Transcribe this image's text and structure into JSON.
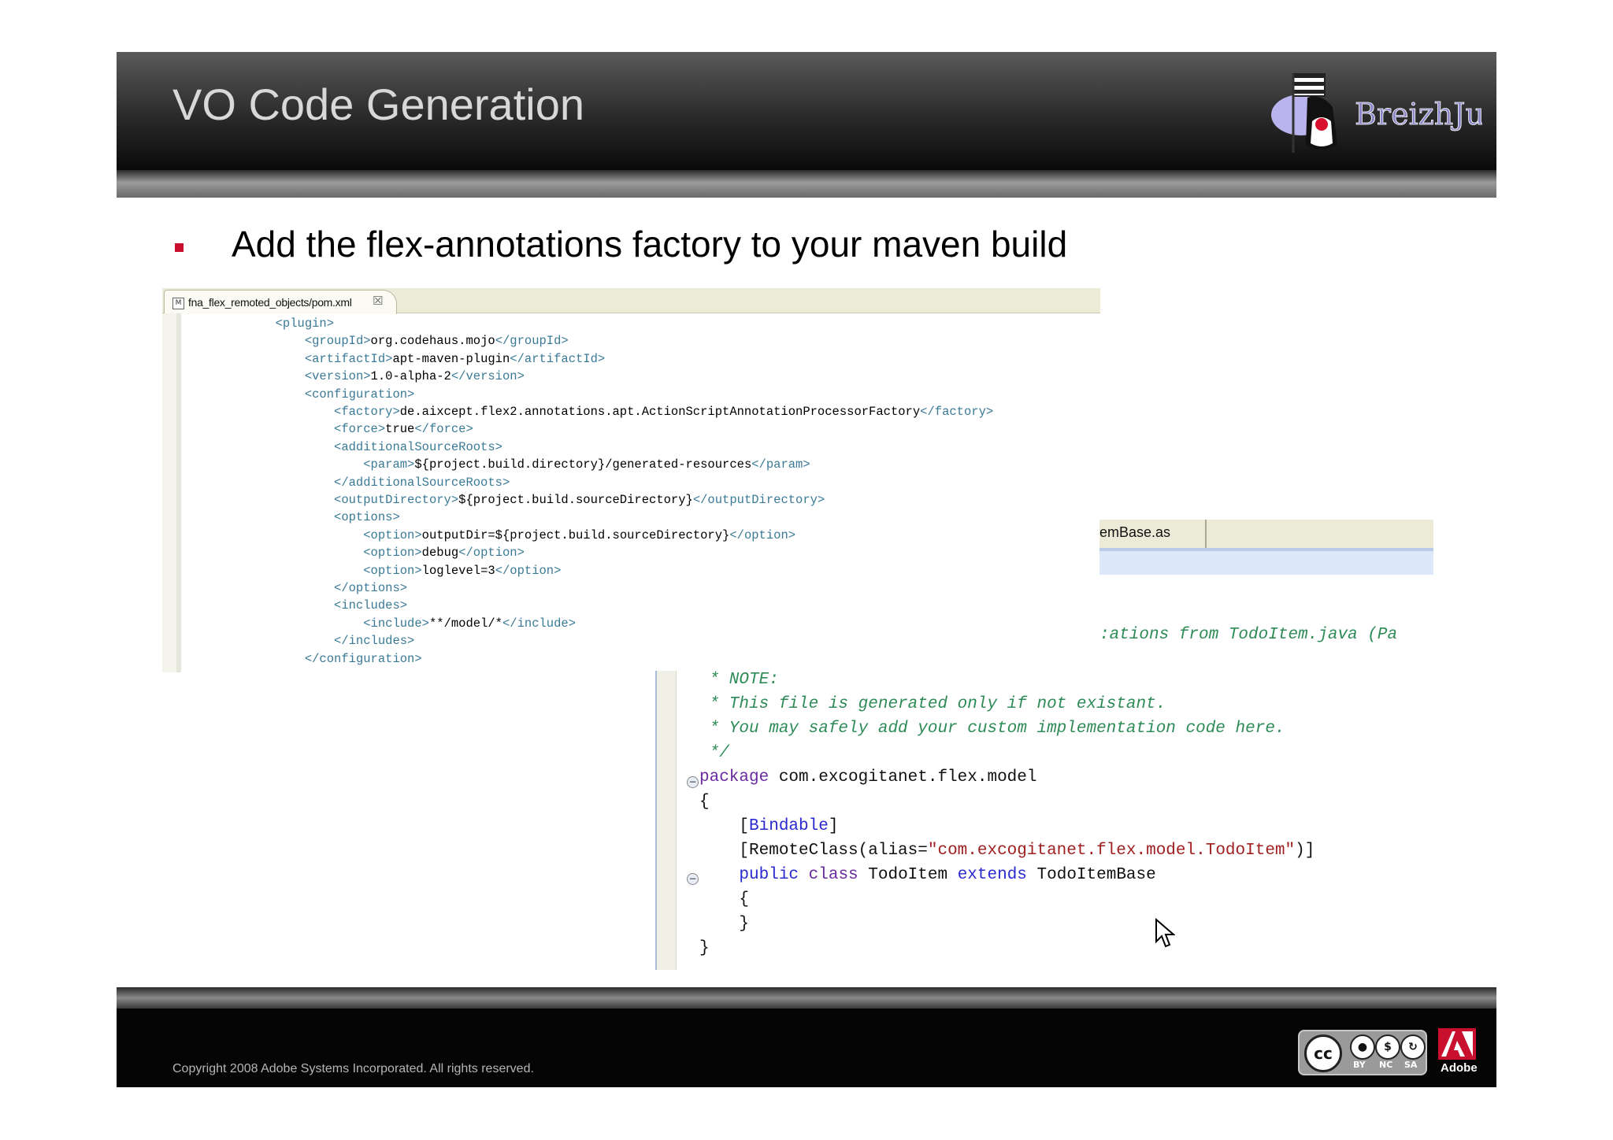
{
  "slide": {
    "title": "VO Code Generation",
    "bullet": "Add the flex-annotations factory to your maven build",
    "copyright": "Copyright 2008 Adobe Systems Incorporated.  All rights reserved."
  },
  "logo": {
    "text": "BreizhJug",
    "icon": "duke-mascot-with-breton-flag-icon"
  },
  "colors": {
    "bullet": "#c8102e",
    "xml_tag": "#3a7a96",
    "comment": "#2e8b57",
    "keyword": "#2a2ad0",
    "string": "#a02020"
  },
  "editor_pom": {
    "tab_label": "fna_flex_remoted_objects/pom.xml",
    "close_glyph": "☒",
    "lines": [
      {
        "indent": "            ",
        "parts": [
          [
            "tag",
            "<plugin>"
          ]
        ]
      },
      {
        "indent": "                ",
        "parts": [
          [
            "tag",
            "<groupId>"
          ],
          [
            "txt",
            "org.codehaus.mojo"
          ],
          [
            "tag",
            "</groupId>"
          ]
        ]
      },
      {
        "indent": "                ",
        "parts": [
          [
            "tag",
            "<artifactId>"
          ],
          [
            "txt",
            "apt-maven-plugin"
          ],
          [
            "tag",
            "</artifactId>"
          ]
        ]
      },
      {
        "indent": "                ",
        "parts": [
          [
            "tag",
            "<version>"
          ],
          [
            "txt",
            "1.0-alpha-2"
          ],
          [
            "tag",
            "</version>"
          ]
        ]
      },
      {
        "indent": "                ",
        "parts": [
          [
            "tag",
            "<configuration>"
          ]
        ]
      },
      {
        "indent": "                    ",
        "parts": [
          [
            "tag",
            "<factory>"
          ],
          [
            "txt",
            "de.aixcept.flex2.annotations.apt.ActionScriptAnnotationProcessorFactory"
          ],
          [
            "tag",
            "</factory>"
          ]
        ]
      },
      {
        "indent": "                    ",
        "parts": [
          [
            "tag",
            "<force>"
          ],
          [
            "txt",
            "true"
          ],
          [
            "tag",
            "</force>"
          ]
        ]
      },
      {
        "indent": "                    ",
        "parts": [
          [
            "tag",
            "<additionalSourceRoots>"
          ]
        ]
      },
      {
        "indent": "                        ",
        "parts": [
          [
            "tag",
            "<param>"
          ],
          [
            "txt",
            "${project.build.directory}/generated-resources"
          ],
          [
            "tag",
            "</param>"
          ]
        ]
      },
      {
        "indent": "                    ",
        "parts": [
          [
            "tag",
            "</additionalSourceRoots>"
          ]
        ]
      },
      {
        "indent": "                    ",
        "parts": [
          [
            "tag",
            "<outputDirectory>"
          ],
          [
            "txt",
            "${project.build.sourceDirectory}"
          ],
          [
            "tag",
            "</outputDirectory>"
          ]
        ]
      },
      {
        "indent": "                    ",
        "parts": [
          [
            "tag",
            "<options>"
          ]
        ]
      },
      {
        "indent": "                        ",
        "parts": [
          [
            "tag",
            "<option>"
          ],
          [
            "txt",
            "outputDir=${project.build.sourceDirectory}"
          ],
          [
            "tag",
            "</option>"
          ]
        ]
      },
      {
        "indent": "                        ",
        "parts": [
          [
            "tag",
            "<option>"
          ],
          [
            "txt",
            "debug"
          ],
          [
            "tag",
            "</option>"
          ]
        ]
      },
      {
        "indent": "                        ",
        "parts": [
          [
            "tag",
            "<option>"
          ],
          [
            "txt",
            "loglevel=3"
          ],
          [
            "tag",
            "</option>"
          ]
        ]
      },
      {
        "indent": "                    ",
        "parts": [
          [
            "tag",
            "</options>"
          ]
        ]
      },
      {
        "indent": "                    ",
        "parts": [
          [
            "tag",
            "<includes>"
          ]
        ]
      },
      {
        "indent": "                        ",
        "parts": [
          [
            "tag",
            "<include>"
          ],
          [
            "txt",
            "**/model/*"
          ],
          [
            "tag",
            "</include>"
          ]
        ]
      },
      {
        "indent": "                    ",
        "parts": [
          [
            "tag",
            "</includes>"
          ]
        ]
      },
      {
        "indent": "                ",
        "parts": [
          [
            "tag",
            "</configuration>"
          ]
        ]
      }
    ]
  },
  "editor_as": {
    "tab_label": "emBase.as",
    "partial_comment": ":ations from TodoItem.java (Pa",
    "lines": [
      {
        "x": 0,
        "parts": [
          [
            "cm",
            " * NOTE:"
          ]
        ]
      },
      {
        "x": 0,
        "parts": [
          [
            "cm",
            " * This file is generated only if not existant."
          ]
        ]
      },
      {
        "x": 0,
        "parts": [
          [
            "cm",
            " * You may safely add your custom implementation code here."
          ]
        ]
      },
      {
        "x": 0,
        "parts": [
          [
            "cm",
            " */"
          ]
        ]
      },
      {
        "x": 0,
        "parts": [
          [
            "kw2",
            "package"
          ],
          [
            "plain",
            " com.excogitanet.flex.model"
          ]
        ]
      },
      {
        "x": 0,
        "parts": [
          [
            "plain",
            "{"
          ]
        ]
      },
      {
        "x": 0,
        "parts": [
          [
            "plain",
            "    ["
          ],
          [
            "kw",
            "Bindable"
          ],
          [
            "plain",
            "]"
          ]
        ]
      },
      {
        "x": 0,
        "parts": [
          [
            "plain",
            "    [RemoteClass(alias="
          ],
          [
            "str",
            "\"com.excogitanet.flex.model.TodoItem\""
          ],
          [
            "plain",
            ")]"
          ]
        ]
      },
      {
        "x": 0,
        "parts": [
          [
            "kw",
            "    public"
          ],
          [
            "kw2",
            " class"
          ],
          [
            "plain",
            " TodoItem "
          ],
          [
            "kw",
            "extends"
          ],
          [
            "plain",
            " TodoItemBase"
          ]
        ]
      },
      {
        "x": 0,
        "parts": [
          [
            "plain",
            "    {"
          ]
        ]
      },
      {
        "x": 0,
        "parts": [
          [
            "plain",
            "    }"
          ]
        ]
      },
      {
        "x": 0,
        "parts": [
          [
            "plain",
            "}"
          ]
        ]
      }
    ]
  },
  "license": {
    "cc": "cc",
    "labels": [
      "BY",
      "NC",
      "SA"
    ],
    "brand": "Adobe"
  }
}
